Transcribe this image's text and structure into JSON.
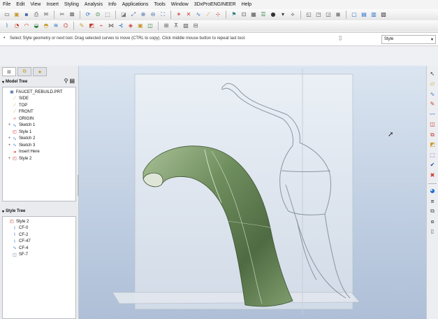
{
  "menu": [
    "File",
    "Edit",
    "View",
    "Insert",
    "Styling",
    "Analysis",
    "Info",
    "Applications",
    "Tools",
    "Window",
    "3DxProENGINEER",
    "Help"
  ],
  "toolbar1": [
    {
      "name": "new-file-icon",
      "glyph": "▭",
      "color": "#4a4a4a"
    },
    {
      "name": "open-file-icon",
      "glyph": "▣",
      "color": "#c99a2e"
    },
    {
      "name": "save-icon",
      "glyph": "▪",
      "color": "#4b6fa8"
    },
    {
      "name": "print-icon",
      "glyph": "⎙",
      "color": "#555555"
    },
    {
      "name": "email-icon",
      "glyph": "✉",
      "color": "#6a6a6a"
    },
    {
      "sep": true
    },
    {
      "name": "cut-icon",
      "glyph": "✂",
      "color": "#555555"
    },
    {
      "name": "close-window-icon",
      "glyph": "⊠",
      "color": "#3a3a3a"
    },
    {
      "sep": true
    },
    {
      "name": "regenerate-icon",
      "glyph": "⟳",
      "color": "#2a6fc9"
    },
    {
      "name": "find-icon",
      "glyph": "⊙",
      "color": "#2f7f3f"
    },
    {
      "name": "select-box-icon",
      "glyph": "⬚",
      "color": "#555555"
    },
    {
      "sep": true
    },
    {
      "name": "repaint-icon",
      "glyph": "◪",
      "color": "#777777"
    },
    {
      "name": "orient-icon",
      "glyph": "⤢",
      "color": "#4b6fa8"
    },
    {
      "name": "zoom-in-icon",
      "glyph": "⊕",
      "color": "#4b6fa8"
    },
    {
      "name": "zoom-out-icon",
      "glyph": "⊖",
      "color": "#4b6fa8"
    },
    {
      "name": "refit-icon",
      "glyph": "⛶",
      "color": "#4b6fa8"
    },
    {
      "sep": true
    },
    {
      "name": "datum-axis-icon",
      "glyph": "✶",
      "color": "#c93a2e"
    },
    {
      "name": "datum-point-icon",
      "glyph": "✕",
      "color": "#c93a2e"
    },
    {
      "name": "datum-curve-icon",
      "glyph": "∿",
      "color": "#2a6fc9"
    },
    {
      "name": "datum-plane-icon",
      "glyph": "⟋",
      "color": "#c99a2e"
    },
    {
      "name": "coordinate-system-icon",
      "glyph": "⊹",
      "color": "#c93a2e"
    },
    {
      "sep": true
    },
    {
      "name": "saved-views-icon",
      "glyph": "⚑",
      "color": "#2f7f7f"
    },
    {
      "name": "spin-center-icon",
      "glyph": "⊡",
      "color": "#555555"
    },
    {
      "name": "view-manager-icon",
      "glyph": "▦",
      "color": "#555555"
    },
    {
      "name": "layers-icon",
      "glyph": "☰",
      "color": "#2f7f3f"
    },
    {
      "name": "appearance-icon",
      "glyph": "●",
      "color": "#333333"
    },
    {
      "name": "dropdown-icon",
      "glyph": "▾",
      "color": "#333333"
    },
    {
      "name": "perspective-icon",
      "glyph": "⟡",
      "color": "#555555"
    },
    {
      "sep": true
    },
    {
      "name": "wireframe-icon",
      "glyph": "◱",
      "color": "#555555"
    },
    {
      "name": "hidden-line-icon",
      "glyph": "◳",
      "color": "#555555"
    },
    {
      "name": "no-hidden-icon",
      "glyph": "◲",
      "color": "#555555"
    },
    {
      "name": "shading-icon",
      "glyph": "◼",
      "color": "#8a8a8a"
    },
    {
      "sep": true
    },
    {
      "name": "datum-display-icon",
      "glyph": "▢",
      "color": "#2a6fc9"
    },
    {
      "name": "axis-display-icon",
      "glyph": "▤",
      "color": "#2a6fc9"
    },
    {
      "name": "point-display-icon",
      "glyph": "▥",
      "color": "#2a6fc9"
    },
    {
      "name": "csys-display-icon",
      "glyph": "▧",
      "color": "#333333"
    }
  ],
  "toolbar2": [
    {
      "name": "style-curve-icon",
      "glyph": "⌇",
      "color": "#2a6fc9"
    },
    {
      "name": "circle-curve-icon",
      "glyph": "◔",
      "color": "#c93a2e"
    },
    {
      "name": "arc-curve-icon",
      "glyph": "◠",
      "color": "#c93a2e"
    },
    {
      "name": "drop-curve-icon",
      "glyph": "◒",
      "color": "#2f7f3f"
    },
    {
      "name": "cos-curve-icon",
      "glyph": "◓",
      "color": "#c99a2e"
    },
    {
      "name": "offset-curve-icon",
      "glyph": "≋",
      "color": "#2a6fc9"
    },
    {
      "name": "obtain-curve-icon",
      "glyph": "⌬",
      "color": "#c93a2e"
    },
    {
      "sep": true
    },
    {
      "name": "edit-curve-icon",
      "glyph": "✎",
      "color": "#c99a2e"
    },
    {
      "name": "curve-edit-icon",
      "glyph": "◩",
      "color": "#c93a2e"
    },
    {
      "name": "split-curve-icon",
      "glyph": "⌁",
      "color": "#c93a2e"
    },
    {
      "name": "trim-curve-icon",
      "glyph": "⋈",
      "color": "#555555"
    },
    {
      "name": "curvature-icon",
      "glyph": "⊰",
      "color": "#2a6fc9"
    },
    {
      "name": "surface-icon",
      "glyph": "◈",
      "color": "#c93a2e"
    },
    {
      "name": "connect-surface-icon",
      "glyph": "▣",
      "color": "#c99a2e"
    },
    {
      "name": "trim-surface-icon",
      "glyph": "◫",
      "color": "#2f7f3f"
    },
    {
      "sep": true
    },
    {
      "name": "curve-analysis-icon",
      "glyph": "⊞",
      "color": "#555555"
    },
    {
      "name": "slope-analysis-icon",
      "glyph": "⊼",
      "color": "#555555"
    },
    {
      "name": "reflection-icon",
      "glyph": "▧",
      "color": "#555555"
    },
    {
      "name": "section-icon",
      "glyph": "⊟",
      "color": "#555555"
    }
  ],
  "message": {
    "text": "Select Style geometry or next tool. Drag selected curves to move (CTRL to copy). Click middle mouse button to repeat last tool."
  },
  "filter": {
    "value": "Style"
  },
  "panel_tabs": [
    {
      "name": "tab-model-tree",
      "glyph": "⊞",
      "color": "#555555"
    },
    {
      "name": "tab-folder-browser",
      "glyph": "⧉",
      "color": "#c99a2e"
    },
    {
      "name": "tab-favorites",
      "glyph": "★",
      "color": "#c99a2e"
    }
  ],
  "model_tree": {
    "title": "Model Tree",
    "items": [
      {
        "label": "FAUCET_REBUILD.PRT",
        "icon": "part-icon",
        "glyph": "▣",
        "color": "#4b6fa8",
        "indent": 0,
        "plus": ""
      },
      {
        "label": "SIDE",
        "icon": "datum-plane-icon",
        "glyph": "⟋",
        "color": "#c99a2e",
        "indent": 1,
        "plus": ""
      },
      {
        "label": "TOP",
        "icon": "datum-plane-icon",
        "glyph": "⟋",
        "color": "#c99a2e",
        "indent": 1,
        "plus": ""
      },
      {
        "label": "FRONT",
        "icon": "datum-plane-icon",
        "glyph": "⟋",
        "color": "#c99a2e",
        "indent": 1,
        "plus": ""
      },
      {
        "label": "ORIGIN",
        "icon": "coordinate-system-icon",
        "glyph": "⊹",
        "color": "#c93a2e",
        "indent": 1,
        "plus": ""
      },
      {
        "label": "Sketch 1",
        "icon": "sketch-icon",
        "glyph": "∿",
        "color": "#2a6fc9",
        "indent": 1,
        "plus": "+"
      },
      {
        "label": "Style 1",
        "icon": "style-feature-icon",
        "glyph": "◰",
        "color": "#c93a2e",
        "indent": 1,
        "plus": ""
      },
      {
        "label": "Sketch 2",
        "icon": "sketch-icon",
        "glyph": "∿",
        "color": "#2a6fc9",
        "indent": 1,
        "plus": "+"
      },
      {
        "label": "Sketch 3",
        "icon": "sketch-icon",
        "glyph": "∿",
        "color": "#2a6fc9",
        "indent": 1,
        "plus": "+"
      },
      {
        "label": "Insert Here",
        "icon": "insert-here-icon",
        "glyph": "➔",
        "color": "#c93a2e",
        "indent": 1,
        "plus": ""
      },
      {
        "label": "Style 2",
        "icon": "style-feature-icon",
        "glyph": "◰",
        "color": "#c93a2e",
        "indent": 1,
        "plus": "+"
      }
    ]
  },
  "style_tree": {
    "title": "Style Tree",
    "items": [
      {
        "label": "Style 2",
        "icon": "style-feature-icon",
        "glyph": "◰",
        "color": "#c93a2e",
        "indent": 0
      },
      {
        "label": "CF-0",
        "icon": "curve-icon",
        "glyph": "⌇",
        "color": "#2a6fc9",
        "indent": 1
      },
      {
        "label": "CF-2",
        "icon": "curve-icon",
        "glyph": "⌇",
        "color": "#2a6fc9",
        "indent": 1
      },
      {
        "label": "CF-47",
        "icon": "curve-icon",
        "glyph": "⌇",
        "color": "#2a6fc9",
        "indent": 1
      },
      {
        "label": "CF-4",
        "icon": "curve-icon",
        "glyph": "∿",
        "color": "#2a6fc9",
        "indent": 1
      },
      {
        "label": "SF-7",
        "icon": "surface-icon",
        "glyph": "◫",
        "color": "#7a8aa8",
        "indent": 1
      }
    ]
  },
  "right_toolbar": [
    {
      "name": "select-tool-icon",
      "glyph": "↖",
      "color": "#333333"
    },
    {
      "name": "plane-tool-icon",
      "glyph": "▱",
      "color": "#c99a2e"
    },
    {
      "name": "curve-tool-icon",
      "glyph": "∿",
      "color": "#2a6fc9"
    },
    {
      "name": "edit-curve-tool-icon",
      "glyph": "✎",
      "color": "#c93a2e"
    },
    {
      "name": "curve-analysis-tool-icon",
      "glyph": "〰",
      "color": "#2a6fc9"
    },
    {
      "name": "surface-tool-icon",
      "glyph": "◫",
      "color": "#c93a2e"
    },
    {
      "name": "connect-tool-icon",
      "glyph": "⧉",
      "color": "#c93a2e"
    },
    {
      "name": "trim-tool-icon",
      "glyph": "◩",
      "color": "#c99a2e"
    },
    {
      "name": "sketch-plane-tool-icon",
      "glyph": "⬚",
      "color": "#7a3aa8"
    },
    {
      "name": "accept-check-icon",
      "glyph": "✔",
      "color": "#1f4fa8"
    },
    {
      "name": "cancel-x-icon",
      "glyph": "✖",
      "color": "#c93a2e"
    },
    {
      "sep": true
    },
    {
      "name": "shade-tool-icon",
      "glyph": "◕",
      "color": "#1f6fd0"
    },
    {
      "name": "layer-tool-icon",
      "glyph": "⧈",
      "color": "#555555"
    },
    {
      "name": "copy-tool-icon",
      "glyph": "⧉",
      "color": "#555555"
    },
    {
      "name": "paste-tool-icon",
      "glyph": "⧇",
      "color": "#555555"
    },
    {
      "name": "window-tool-icon",
      "glyph": "▯",
      "color": "#555555"
    }
  ]
}
